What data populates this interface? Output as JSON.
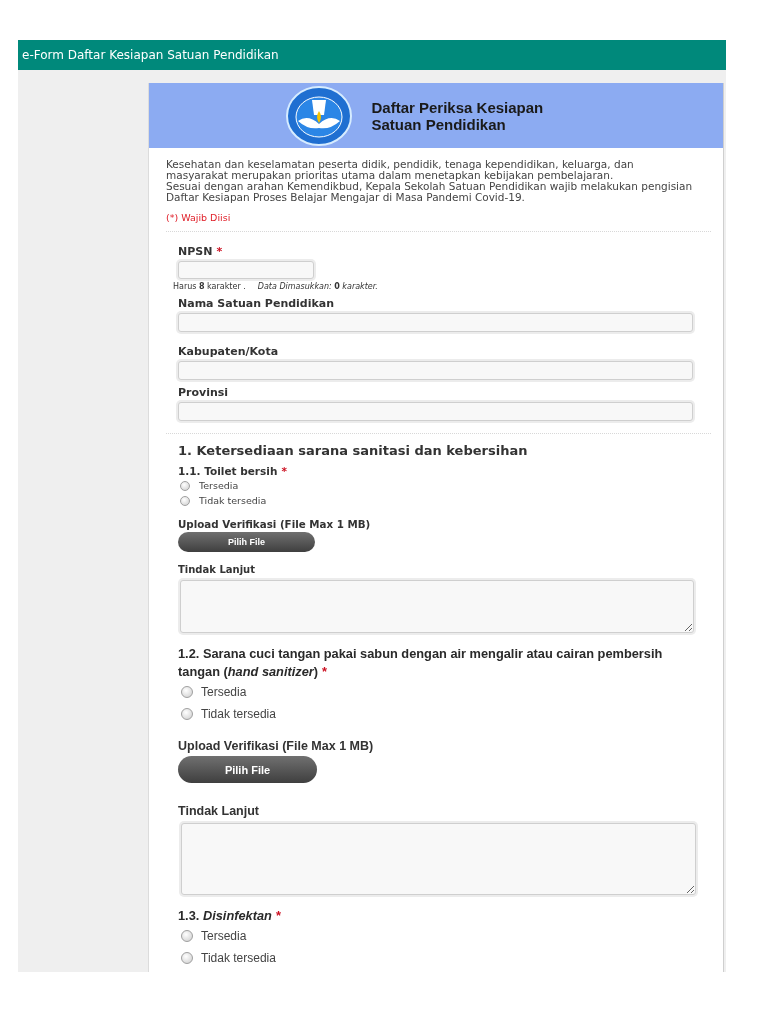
{
  "top_bar": {
    "title": "e-Form Daftar Kesiapan Satuan Pendidikan"
  },
  "form_header": {
    "title": "Daftar Periksa Kesiapan Satuan Pendidikan"
  },
  "intro": [
    "Kesehatan dan keselamatan peserta didik, pendidik, tenaga kependidikan, keluarga, dan masyarakat merupakan prioritas utama dalam menetapkan kebijakan pembelajaran.",
    "Sesuai dengan arahan Kemendikbud, Kepala Sekolah Satuan Pendidikan wajib melakukan pengisian Daftar Kesiapan Proses Belajar Mengajar di Masa Pandemi Covid-19."
  ],
  "required_note": "(*) Wajib Diisi",
  "fields": [
    {
      "kind": "short",
      "label": "NPSN",
      "required_mark": "*",
      "hints": [
        "Harus **8** karakter .",
        "*Data Dimasukkan:* **0** *karakter.*"
      ]
    },
    {
      "kind": "wide",
      "label": "Nama Satuan Pendidikan"
    },
    {
      "kind": "wide",
      "label": "Kabupaten/Kota"
    },
    {
      "kind": "wide",
      "label": "Provinsi"
    }
  ],
  "sections": [
    {
      "title": "1. Ketersediaan sarana sanitasi dan kebersihan",
      "questions": [
        {
          "label": "1.1. Toilet bersih",
          "required_mark": "*",
          "options": [
            {
              "label": "Tersedia",
              "selected": false
            },
            {
              "label": "Tidak tersedia",
              "selected": false
            }
          ],
          "upload": {
            "label": "Upload Verifikasi (File Max 1 MB)",
            "button": "Pilih File"
          },
          "follow_up": {
            "label": "Tindak Lanjut"
          }
        },
        {
          "label": "1.2. Sarana cuci tangan pakai sabun dengan air mengalir atau cairan pembersih tangan (*hand sanitizer*)",
          "required_mark": "*",
          "options": [
            {
              "label": "Tersedia",
              "selected": false
            },
            {
              "label": "Tidak tersedia",
              "selected": false
            }
          ],
          "upload": {
            "label": "Upload Verifikasi (File Max 1 MB)",
            "button": "Pilih File"
          },
          "follow_up": {
            "label": "Tindak Lanjut"
          }
        },
        {
          "label": "1.3. *Disinfektan*",
          "required_mark": "*",
          "options": [
            {
              "label": "Tersedia",
              "selected": false
            },
            {
              "label": "Tidak tersedia",
              "selected": false
            }
          ]
        }
      ]
    }
  ]
}
